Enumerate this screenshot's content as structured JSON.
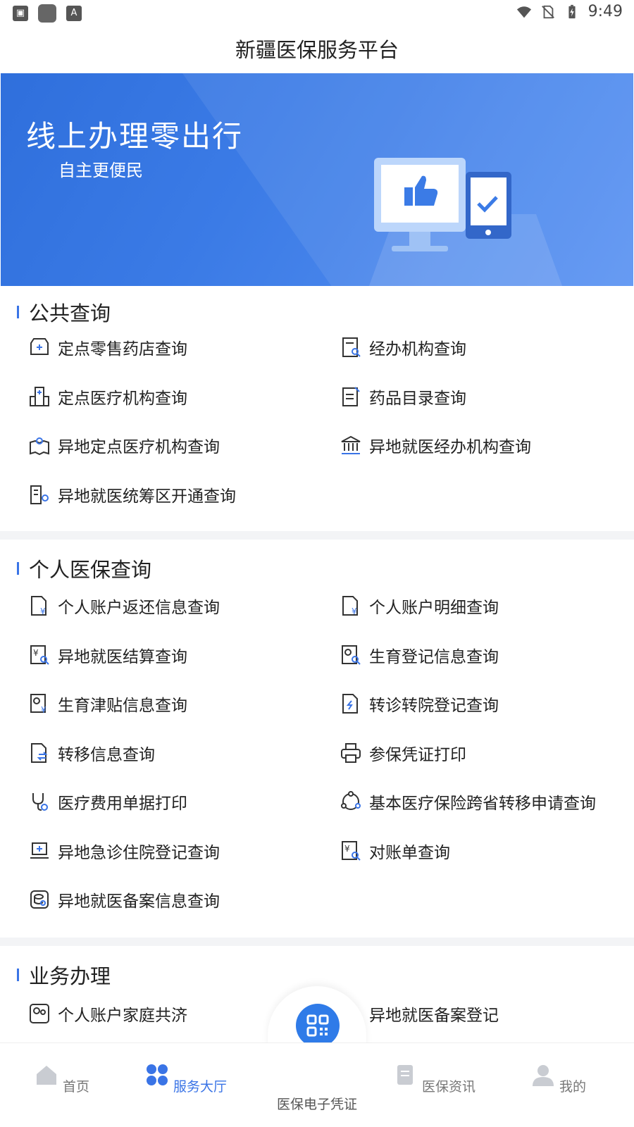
{
  "status_bar": {
    "time": "9:49"
  },
  "app": {
    "title": "新疆医保服务平台"
  },
  "banner": {
    "title": "线上办理零出行",
    "subtitle": "自主更便民"
  },
  "sections": {
    "public": {
      "title": "公共查询",
      "items": [
        "定点零售药店查询",
        "经办机构查询",
        "定点医疗机构查询",
        "药品目录查询",
        "异地定点医疗机构查询",
        "异地就医经办机构查询",
        "异地就医统筹区开通查询"
      ]
    },
    "personal": {
      "title": "个人医保查询",
      "items": [
        "个人账户返还信息查询",
        "个人账户明细查询",
        "异地就医结算查询",
        "生育登记信息查询",
        "生育津贴信息查询",
        "转诊转院登记查询",
        "转移信息查询",
        "参保凭证打印",
        "医疗费用单据打印",
        "基本医疗保险跨省转移申请查询",
        "异地急诊住院登记查询",
        "对账单查询",
        "异地就医备案信息查询"
      ]
    },
    "business": {
      "title": "业务办理",
      "items": [
        "个人账户家庭共济",
        "异地就医备案登记"
      ]
    }
  },
  "bottom_nav": {
    "items": [
      "首页",
      "服务大厅",
      "医保电子凭证",
      "医保资讯",
      "我的"
    ],
    "active_index": 1
  },
  "colors": {
    "accent": "#3a74e6",
    "banner": "#3b7be6",
    "text": "#222222"
  }
}
